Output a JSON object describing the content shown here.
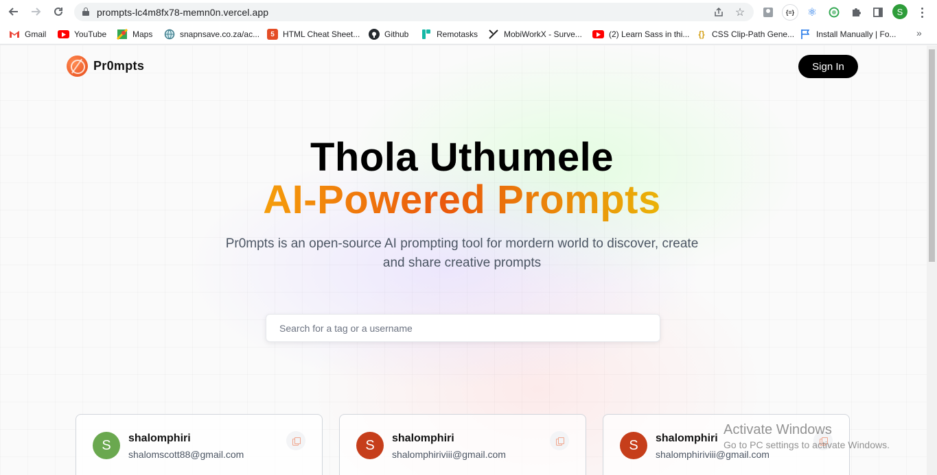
{
  "browser": {
    "url": "prompts-lc4m8fx78-memn0n.vercel.app",
    "profile_initial": "S",
    "bookmarks": [
      {
        "label": "Gmail",
        "icon": "gmail-icon"
      },
      {
        "label": "YouTube",
        "icon": "youtube-icon"
      },
      {
        "label": "Maps",
        "icon": "maps-icon"
      },
      {
        "label": "snapnsave.co.za/ac...",
        "icon": "globe-icon"
      },
      {
        "label": "HTML Cheat Sheet...",
        "icon": "html-icon"
      },
      {
        "label": "Github",
        "icon": "github-icon"
      },
      {
        "label": "Remotasks",
        "icon": "remotasks-icon"
      },
      {
        "label": "MobiWorkX - Surve...",
        "icon": "mobiworkx-icon"
      },
      {
        "label": "(2) Learn Sass in thi...",
        "icon": "youtube-icon"
      },
      {
        "label": "CSS Clip-Path Gene...",
        "icon": "css-icon"
      },
      {
        "label": "Install Manually | Fo...",
        "icon": "flag-icon"
      }
    ]
  },
  "header": {
    "brand": "Pr0mpts",
    "signin_label": "Sign In"
  },
  "hero": {
    "title": "Thola Uthumele",
    "subtitle": "AI-Powered Prompts",
    "description": "Pr0mpts is an open-source AI prompting tool for mordern world to discover, create and share creative prompts"
  },
  "search": {
    "placeholder": "Search for a tag or a username"
  },
  "cards": [
    {
      "username": "shalomphiri",
      "email": "shalomscott88@gmail.com",
      "initial": "S",
      "color": "#6aa84f"
    },
    {
      "username": "shalomphiri",
      "email": "shalomphiriviii@gmail.com",
      "initial": "S",
      "color": "#c63e1b"
    },
    {
      "username": "shalomphiri",
      "email": "shalomphiriviii@gmail.com",
      "initial": "S",
      "color": "#c63e1b"
    }
  ],
  "watermark": {
    "line1": "Activate Windows",
    "line2": "Go to PC settings to activate Windows."
  }
}
